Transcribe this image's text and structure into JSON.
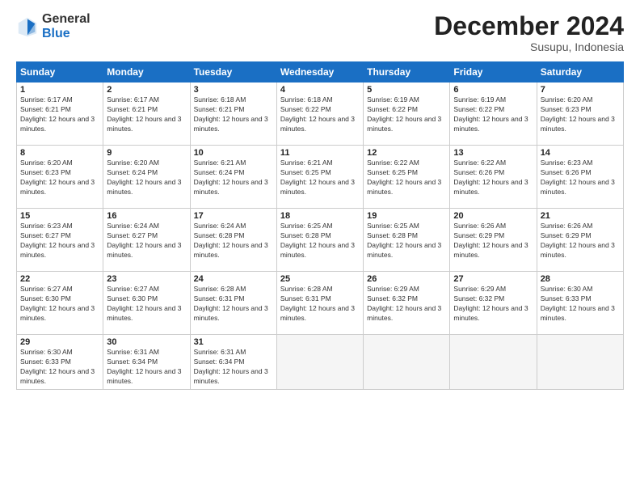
{
  "logo": {
    "general": "General",
    "blue": "Blue"
  },
  "header": {
    "month": "December 2024",
    "location": "Susupu, Indonesia"
  },
  "weekdays": [
    "Sunday",
    "Monday",
    "Tuesday",
    "Wednesday",
    "Thursday",
    "Friday",
    "Saturday"
  ],
  "days": [
    {
      "date": 1,
      "sunrise": "6:17 AM",
      "sunset": "6:21 PM",
      "daylight": "12 hours and 3 minutes."
    },
    {
      "date": 2,
      "sunrise": "6:17 AM",
      "sunset": "6:21 PM",
      "daylight": "12 hours and 3 minutes."
    },
    {
      "date": 3,
      "sunrise": "6:18 AM",
      "sunset": "6:21 PM",
      "daylight": "12 hours and 3 minutes."
    },
    {
      "date": 4,
      "sunrise": "6:18 AM",
      "sunset": "6:22 PM",
      "daylight": "12 hours and 3 minutes."
    },
    {
      "date": 5,
      "sunrise": "6:19 AM",
      "sunset": "6:22 PM",
      "daylight": "12 hours and 3 minutes."
    },
    {
      "date": 6,
      "sunrise": "6:19 AM",
      "sunset": "6:22 PM",
      "daylight": "12 hours and 3 minutes."
    },
    {
      "date": 7,
      "sunrise": "6:20 AM",
      "sunset": "6:23 PM",
      "daylight": "12 hours and 3 minutes."
    },
    {
      "date": 8,
      "sunrise": "6:20 AM",
      "sunset": "6:23 PM",
      "daylight": "12 hours and 3 minutes."
    },
    {
      "date": 9,
      "sunrise": "6:20 AM",
      "sunset": "6:24 PM",
      "daylight": "12 hours and 3 minutes."
    },
    {
      "date": 10,
      "sunrise": "6:21 AM",
      "sunset": "6:24 PM",
      "daylight": "12 hours and 3 minutes."
    },
    {
      "date": 11,
      "sunrise": "6:21 AM",
      "sunset": "6:25 PM",
      "daylight": "12 hours and 3 minutes."
    },
    {
      "date": 12,
      "sunrise": "6:22 AM",
      "sunset": "6:25 PM",
      "daylight": "12 hours and 3 minutes."
    },
    {
      "date": 13,
      "sunrise": "6:22 AM",
      "sunset": "6:26 PM",
      "daylight": "12 hours and 3 minutes."
    },
    {
      "date": 14,
      "sunrise": "6:23 AM",
      "sunset": "6:26 PM",
      "daylight": "12 hours and 3 minutes."
    },
    {
      "date": 15,
      "sunrise": "6:23 AM",
      "sunset": "6:27 PM",
      "daylight": "12 hours and 3 minutes."
    },
    {
      "date": 16,
      "sunrise": "6:24 AM",
      "sunset": "6:27 PM",
      "daylight": "12 hours and 3 minutes."
    },
    {
      "date": 17,
      "sunrise": "6:24 AM",
      "sunset": "6:28 PM",
      "daylight": "12 hours and 3 minutes."
    },
    {
      "date": 18,
      "sunrise": "6:25 AM",
      "sunset": "6:28 PM",
      "daylight": "12 hours and 3 minutes."
    },
    {
      "date": 19,
      "sunrise": "6:25 AM",
      "sunset": "6:28 PM",
      "daylight": "12 hours and 3 minutes."
    },
    {
      "date": 20,
      "sunrise": "6:26 AM",
      "sunset": "6:29 PM",
      "daylight": "12 hours and 3 minutes."
    },
    {
      "date": 21,
      "sunrise": "6:26 AM",
      "sunset": "6:29 PM",
      "daylight": "12 hours and 3 minutes."
    },
    {
      "date": 22,
      "sunrise": "6:27 AM",
      "sunset": "6:30 PM",
      "daylight": "12 hours and 3 minutes."
    },
    {
      "date": 23,
      "sunrise": "6:27 AM",
      "sunset": "6:30 PM",
      "daylight": "12 hours and 3 minutes."
    },
    {
      "date": 24,
      "sunrise": "6:28 AM",
      "sunset": "6:31 PM",
      "daylight": "12 hours and 3 minutes."
    },
    {
      "date": 25,
      "sunrise": "6:28 AM",
      "sunset": "6:31 PM",
      "daylight": "12 hours and 3 minutes."
    },
    {
      "date": 26,
      "sunrise": "6:29 AM",
      "sunset": "6:32 PM",
      "daylight": "12 hours and 3 minutes."
    },
    {
      "date": 27,
      "sunrise": "6:29 AM",
      "sunset": "6:32 PM",
      "daylight": "12 hours and 3 minutes."
    },
    {
      "date": 28,
      "sunrise": "6:30 AM",
      "sunset": "6:33 PM",
      "daylight": "12 hours and 3 minutes."
    },
    {
      "date": 29,
      "sunrise": "6:30 AM",
      "sunset": "6:33 PM",
      "daylight": "12 hours and 3 minutes."
    },
    {
      "date": 30,
      "sunrise": "6:31 AM",
      "sunset": "6:34 PM",
      "daylight": "12 hours and 3 minutes."
    },
    {
      "date": 31,
      "sunrise": "6:31 AM",
      "sunset": "6:34 PM",
      "daylight": "12 hours and 3 minutes."
    }
  ],
  "labels": {
    "sunrise": "Sunrise:",
    "sunset": "Sunset:",
    "daylight": "Daylight:"
  }
}
